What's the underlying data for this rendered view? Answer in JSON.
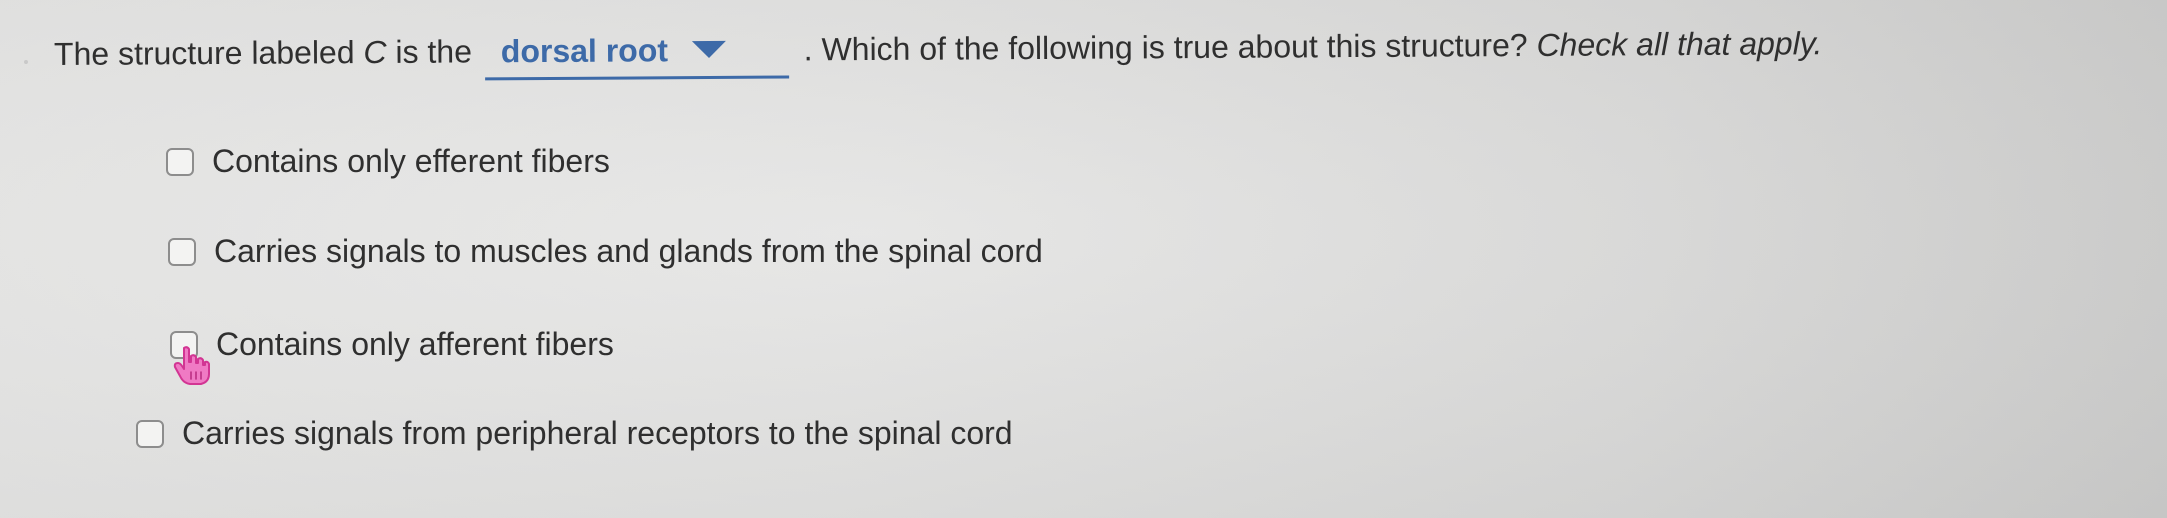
{
  "question": {
    "part1": "The structure labeled",
    "variable": "C",
    "part2": "is the",
    "dropdown_value": "dorsal root",
    "part3": ". Which of the following is true about this structure?",
    "instruction": "Check all that apply."
  },
  "options": [
    {
      "label": "Contains only efferent fibers",
      "checked": false
    },
    {
      "label": "Carries signals to muscles and glands from the spinal cord",
      "checked": false
    },
    {
      "label": "Contains only afferent fibers",
      "checked": false
    },
    {
      "label": "Carries signals from peripheral receptors to the spinal cord",
      "checked": false
    }
  ],
  "icons": {
    "dropdown": "caret-down-icon",
    "cursor": "hand-pointer-icon"
  },
  "colors": {
    "accent": "#3d6aa8",
    "text": "#2f2f2f",
    "checkbox_border": "#8d8d8d",
    "cursor": "#e040a0"
  }
}
